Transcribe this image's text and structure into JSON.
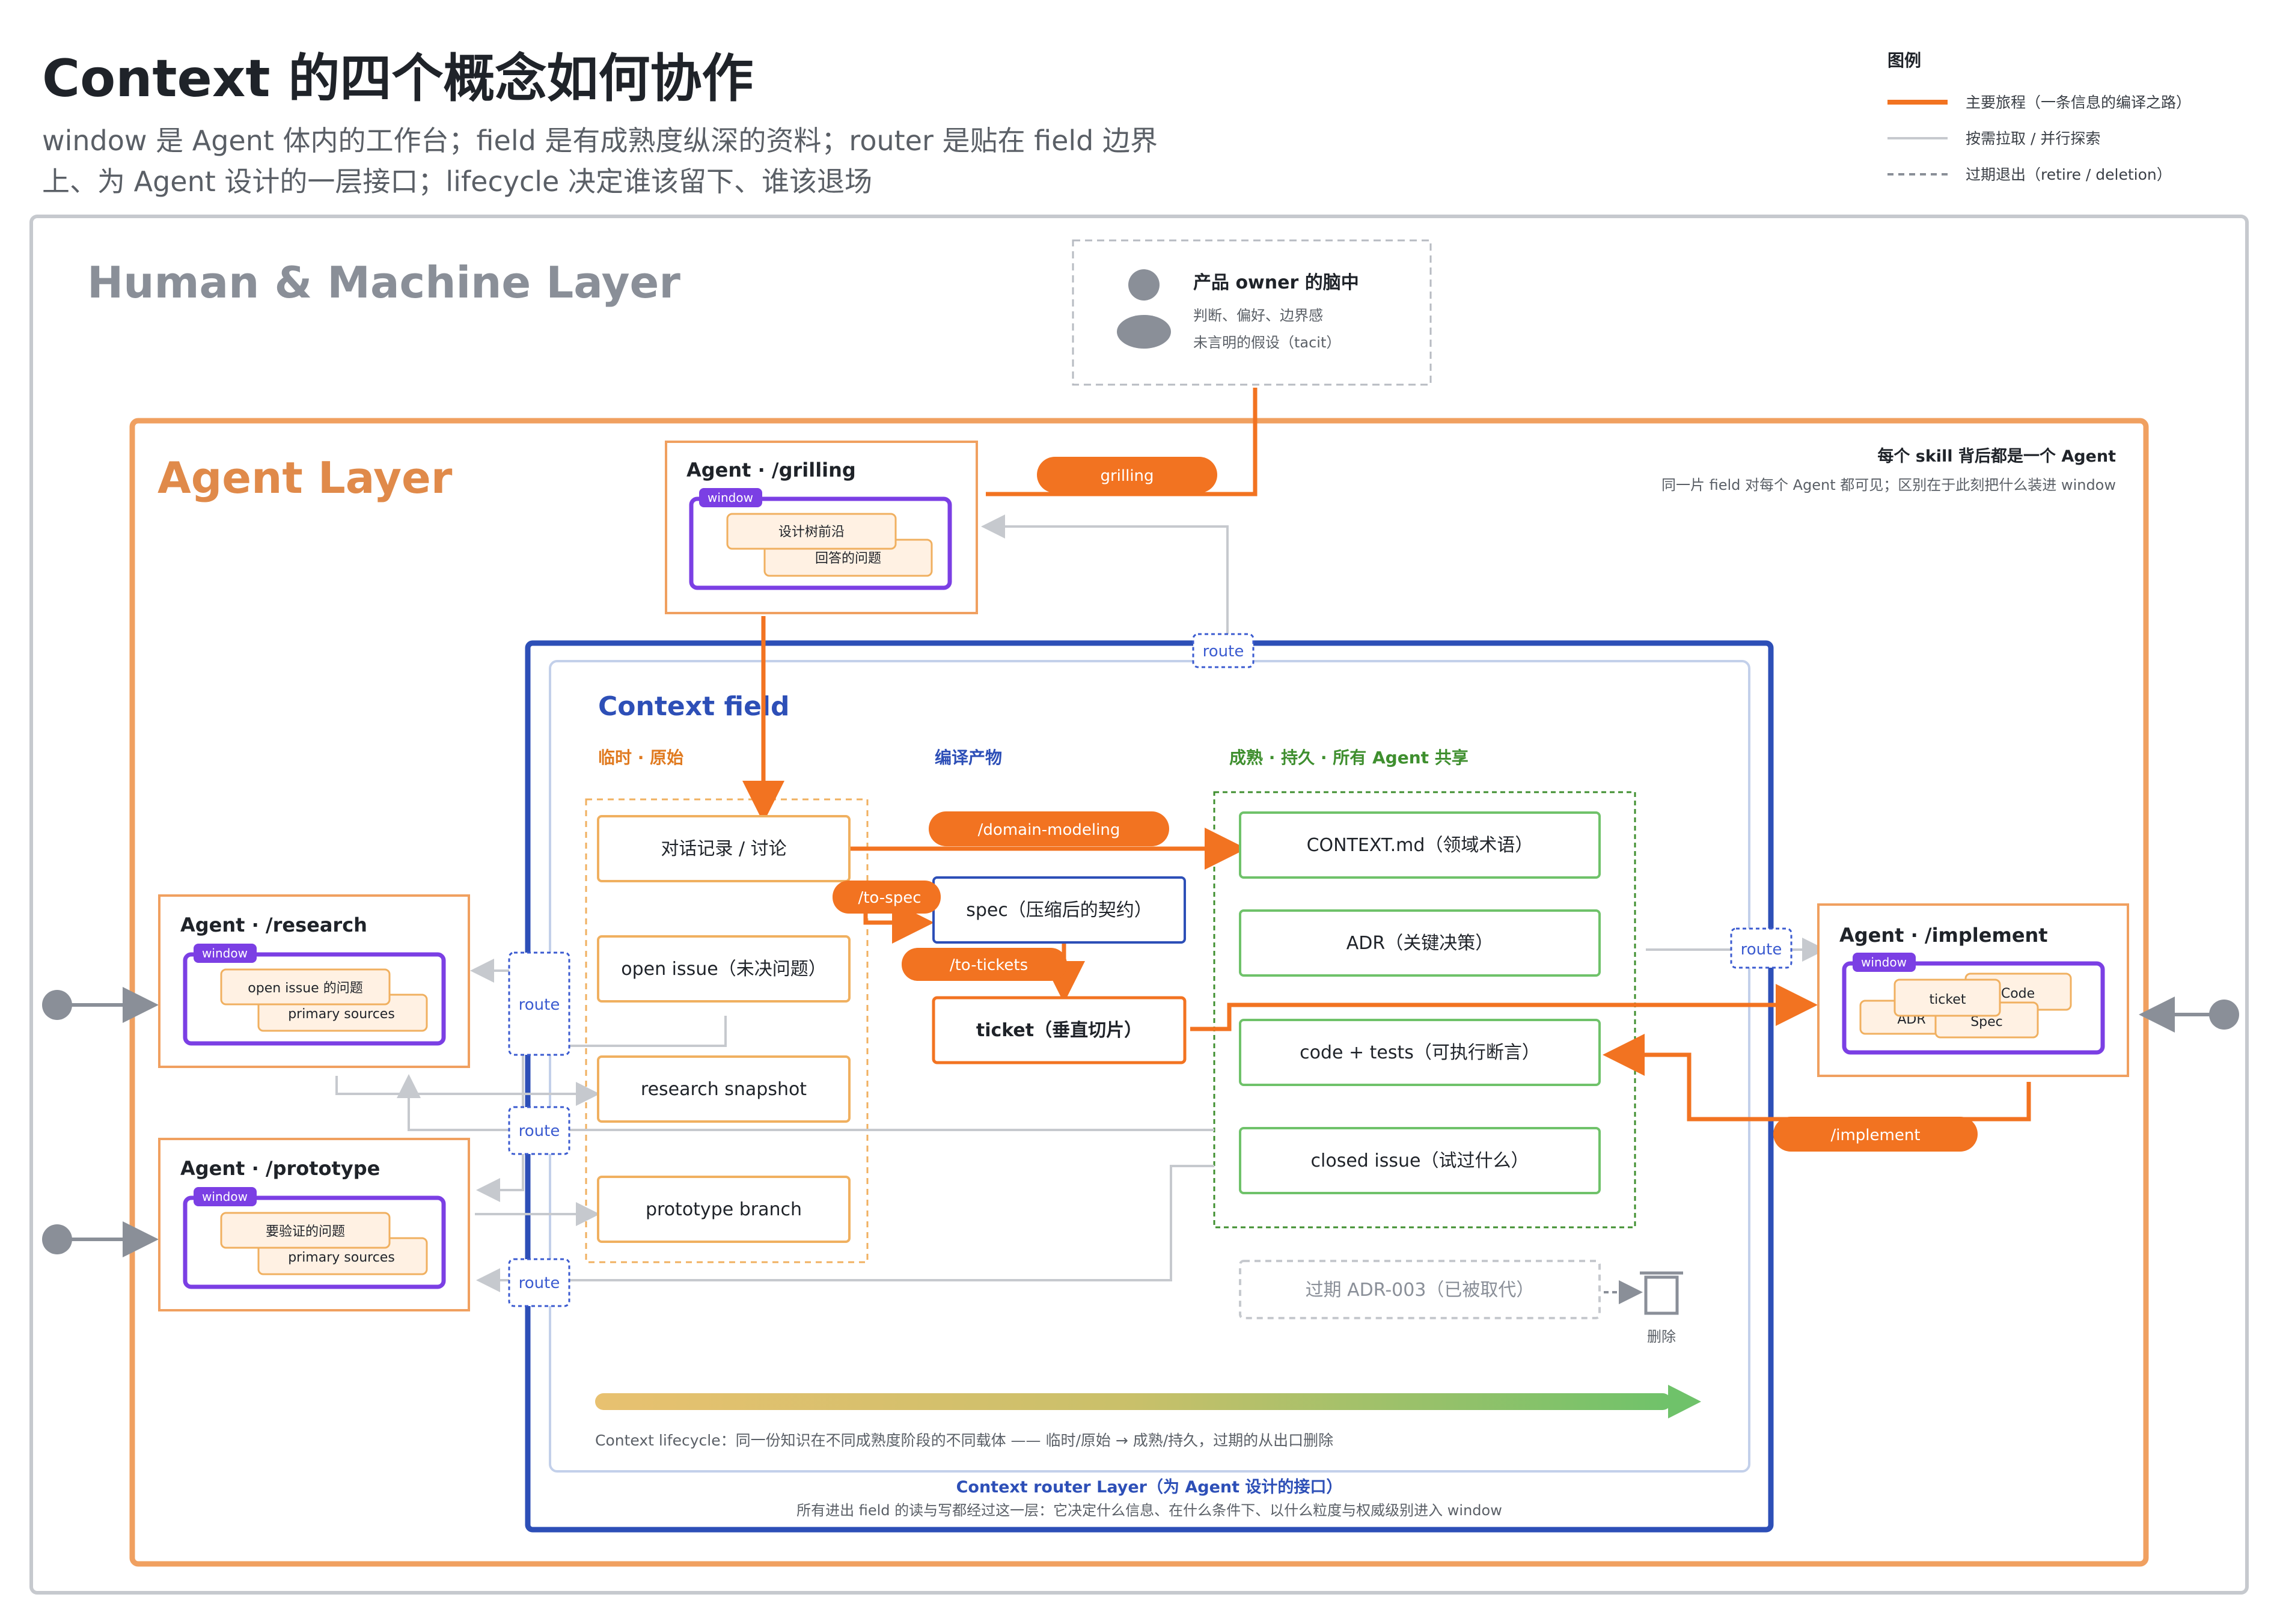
{
  "header": {
    "title": "Context 的四个概念如何协作",
    "subtitle_line1": "window 是 Agent 体内的工作台；field 是有成熟度纵深的资料；router 是贴在 field 边界",
    "subtitle_line2": "上、为 Agent 设计的一层接口；lifecycle 决定谁该留下、谁该退场"
  },
  "legend": {
    "title": "图例",
    "items": [
      {
        "label": "主要旅程（一条信息的编译之路）",
        "color": "#f27321"
      },
      {
        "label": "按需拉取 / 并行探索",
        "color": "#c6c9ce"
      },
      {
        "label": "过期退出（retire / deletion）",
        "color": "#8a8f98"
      }
    ]
  },
  "human_layer": {
    "title": "Human & Machine Layer",
    "owner": {
      "title": "产品 owner 的脑中",
      "line1": "判断、偏好、边界感",
      "line2": "未言明的假设（tacit）"
    }
  },
  "agent_layer": {
    "title": "Agent Layer",
    "note_title": "每个 skill 背后都是一个 Agent",
    "note_text": "同一片 field 对每个 Agent 都可见；区别在于此刻把什么装进 window"
  },
  "agents": {
    "grilling": {
      "title": "Agent · /grilling",
      "window_tag": "window",
      "card1": "设计树前沿",
      "card2": "回答的问题"
    },
    "research": {
      "title": "Agent · /research",
      "window_tag": "window",
      "card1": "open issue 的问题",
      "card2": "primary sources"
    },
    "prototype": {
      "title": "Agent · /prototype",
      "window_tag": "window",
      "card1": "要验证的问题",
      "card2": "primary sources"
    },
    "implement": {
      "title": "Agent · /implement",
      "window_tag": "window",
      "card_ticket": "ticket",
      "card_code": "Code",
      "card_adr": "ADR",
      "card_spec": "Spec"
    }
  },
  "context_field": {
    "title": "Context field",
    "col_raw": "临时 · 原始",
    "col_artifacts": "编译产物",
    "col_mature": "成熟 · 持久 · 所有 Agent 共享",
    "raw_items": [
      "对话记录 / 讨论",
      "open issue（未决问题）",
      "research snapshot",
      "prototype branch"
    ],
    "artifacts": {
      "spec": "spec（压缩后的契约）",
      "ticket": "ticket（垂直切片）"
    },
    "mature_items": [
      "CONTEXT.md（领域术语）",
      "ADR（关键决策）",
      "code + tests（可执行断言）",
      "closed issue（试过什么）"
    ],
    "expired": "过期 ADR-003（已被取代）",
    "delete_label": "删除",
    "lifecycle_text": "Context lifecycle：同一份知识在不同成熟度阶段的不同载体 —— 临时/原始 → 成熟/持久，过期的从出口删除"
  },
  "router_layer": {
    "title": "Context router Layer（为 Agent 设计的接口）",
    "text": "所有进出 field 的读与写都经过这一层：它决定什么信息、在什么条件下、以什么粒度与权威级别进入 window"
  },
  "connector_labels": {
    "grilling": "grilling",
    "domain_modeling": "/domain-modeling",
    "to_spec": "/to-spec",
    "to_tickets": "/to-tickets",
    "implement": "/implement",
    "route": "route"
  },
  "colors": {
    "orange": "#f27321",
    "agent_border": "#f0a060",
    "purple": "#7b3fe4",
    "router_blue": "#2d4fb7",
    "green": "#3f9f3f",
    "gray": "#c6c9ce"
  }
}
